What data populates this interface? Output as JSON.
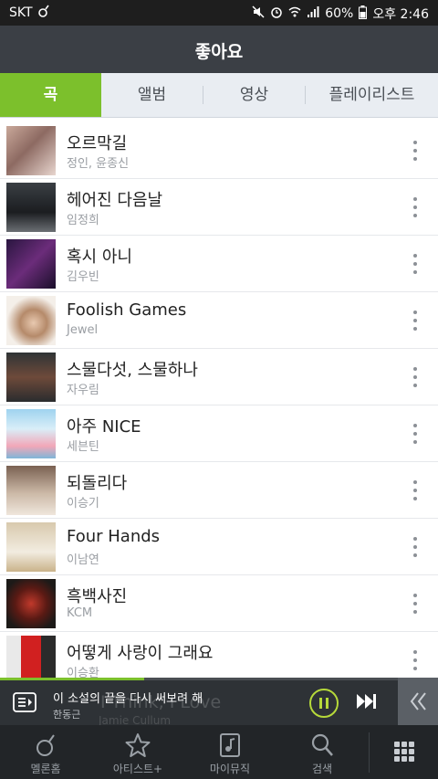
{
  "status": {
    "carrier": "SKT",
    "battery": "60%",
    "time": "오후 2:46"
  },
  "header": {
    "title": "좋아요"
  },
  "tabs": [
    {
      "label": "곡",
      "active": true
    },
    {
      "label": "앨범",
      "active": false
    },
    {
      "label": "영상",
      "active": false
    },
    {
      "label": "플레이리스트",
      "active": false
    }
  ],
  "songs": [
    {
      "title": "오르막길",
      "artist": "정인, 윤종신"
    },
    {
      "title": "헤어진 다음날",
      "artist": "임정희"
    },
    {
      "title": "혹시 아니",
      "artist": "김우빈"
    },
    {
      "title": "Foolish Games",
      "artist": "Jewel"
    },
    {
      "title": "스물다섯, 스물하나",
      "artist": "자우림"
    },
    {
      "title": "아주 NICE",
      "artist": "세븐틴"
    },
    {
      "title": "되돌리다",
      "artist": "이승기"
    },
    {
      "title": "Four Hands",
      "artist": "이남연"
    },
    {
      "title": "흑백사진",
      "artist": "KCM"
    },
    {
      "title": "어떻게 사랑이 그래요",
      "artist": "이승환"
    }
  ],
  "player": {
    "title": "이 소설의 끝을 다시 써보려 해",
    "artist": "한동근",
    "bg_title": "I Think, I Love",
    "bg_artist": "Jamie Cullum",
    "progress": 0.33
  },
  "nav": [
    {
      "label": "멜론홈",
      "icon": "melon-home-icon"
    },
    {
      "label": "아티스트+",
      "icon": "star-icon"
    },
    {
      "label": "마이뮤직",
      "icon": "my-music-icon"
    },
    {
      "label": "검색",
      "icon": "search-icon"
    },
    {
      "label": "",
      "icon": "grid-menu-icon"
    }
  ],
  "colors": {
    "accent": "#7cc02c",
    "header": "#3b3f45",
    "tabs_bg": "#e9edf2",
    "player_bg": "#2e3236",
    "nav_bg": "#222528"
  }
}
